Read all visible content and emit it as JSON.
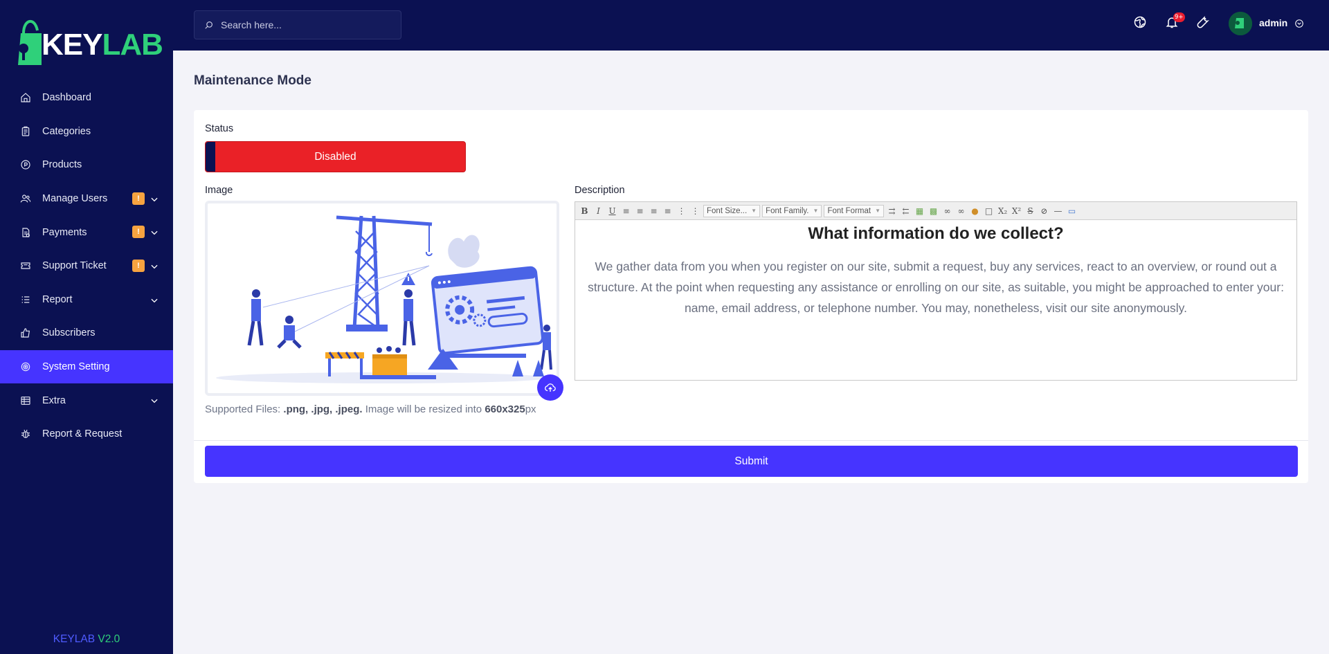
{
  "brand": {
    "logo_left": "KEY",
    "logo_right": "LAB",
    "version_left": "KEYLAB",
    "version_right": "V2.0",
    "accent": "#4634ff",
    "green": "#2fd07a",
    "sidebar_bg": "#0b1152"
  },
  "sidebar": {
    "items": [
      {
        "label": "Dashboard",
        "icon": "home-icon"
      },
      {
        "label": "Categories",
        "icon": "clipboard-icon"
      },
      {
        "label": "Products",
        "icon": "product-icon"
      },
      {
        "label": "Manage Users",
        "icon": "users-icon",
        "badge": "!"
      },
      {
        "label": "Payments",
        "icon": "payments-icon",
        "badge": "!"
      },
      {
        "label": "Support Ticket",
        "icon": "ticket-icon",
        "badge": "!"
      },
      {
        "label": "Report",
        "icon": "list-icon"
      },
      {
        "label": "Subscribers",
        "icon": "thumbs-up-icon"
      },
      {
        "label": "System Setting",
        "icon": "settings-icon"
      },
      {
        "label": "Extra",
        "icon": "extra-icon"
      },
      {
        "label": "Report & Request",
        "icon": "bug-icon"
      }
    ]
  },
  "topbar": {
    "search_placeholder": "Search here...",
    "notification_count": "9+",
    "username": "admin"
  },
  "page": {
    "title": "Maintenance Mode",
    "status_label": "Status",
    "status_value": "Disabled",
    "image_label": "Image",
    "description_label": "Description",
    "supported_prefix": "Supported Files: ",
    "supported_types": ".png, .jpg, .jpeg.",
    "supported_middle": " Image will be resized into ",
    "supported_size": "660x325",
    "supported_suffix": "px",
    "submit_label": "Submit"
  },
  "editor": {
    "font_size": "Font Size...",
    "font_family": "Font Family.",
    "font_format": "Font Format",
    "heading": "What information do we collect?",
    "body": "We gather data from you when you register on our site, submit a request, buy any services, react to an overview, or round out a structure. At the point when requesting any assistance or enrolling on our site, as suitable, you might be approached to enter your: name, email address, or telephone number. You may, nonetheless, visit our site anonymously."
  }
}
